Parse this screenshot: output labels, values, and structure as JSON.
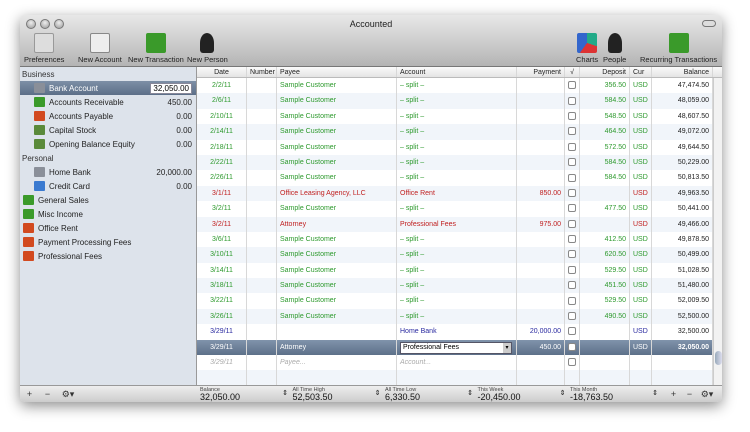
{
  "window": {
    "title": "Accounted"
  },
  "toolbar": {
    "preferences": "Preferences",
    "new_account": "New Account",
    "new_transaction": "New Transaction",
    "new_person": "New Person",
    "charts": "Charts",
    "people": "People",
    "recurring": "Recurring Transactions"
  },
  "sidebar": {
    "groups": [
      {
        "label": "Business",
        "items": [
          {
            "label": "Bank Account",
            "value": "32,050.00",
            "icon": "bank-icon",
            "selected": true
          },
          {
            "label": "Accounts Receivable",
            "value": "450.00",
            "icon": "income-icon"
          },
          {
            "label": "Accounts Payable",
            "value": "0.00",
            "icon": "expense-icon"
          },
          {
            "label": "Capital Stock",
            "value": "0.00",
            "icon": "equity-icon"
          },
          {
            "label": "Opening Balance Equity",
            "value": "0.00",
            "icon": "equity-icon"
          }
        ]
      },
      {
        "label": "Personal",
        "items": [
          {
            "label": "Home Bank",
            "value": "20,000.00",
            "icon": "bank-icon"
          },
          {
            "label": "Credit Card",
            "value": "0.00",
            "icon": "credit-card-icon"
          }
        ]
      }
    ],
    "categories": [
      {
        "label": "General Sales",
        "icon": "income-icon"
      },
      {
        "label": "Misc Income",
        "icon": "income-icon"
      },
      {
        "label": "Office Rent",
        "icon": "expense-icon"
      },
      {
        "label": "Payment Processing Fees",
        "icon": "expense-icon"
      },
      {
        "label": "Professional Fees",
        "icon": "expense-icon"
      }
    ]
  },
  "table": {
    "columns": [
      "Date",
      "Number",
      "Payee",
      "Account",
      "Payment",
      "√",
      "Deposit",
      "Cur",
      "Balance"
    ],
    "rows": [
      {
        "date": "2/2/11",
        "payee": "Sample Customer",
        "account": "– split –",
        "payment": "",
        "deposit": "356.50",
        "cur": "USD",
        "balance": "47,474.50",
        "color": "g"
      },
      {
        "date": "2/6/11",
        "payee": "Sample Customer",
        "account": "– split –",
        "payment": "",
        "deposit": "584.50",
        "cur": "USD",
        "balance": "48,059.00",
        "color": "g"
      },
      {
        "date": "2/10/11",
        "payee": "Sample Customer",
        "account": "– split –",
        "payment": "",
        "deposit": "548.50",
        "cur": "USD",
        "balance": "48,607.50",
        "color": "g"
      },
      {
        "date": "2/14/11",
        "payee": "Sample Customer",
        "account": "– split –",
        "payment": "",
        "deposit": "464.50",
        "cur": "USD",
        "balance": "49,072.00",
        "color": "g"
      },
      {
        "date": "2/18/11",
        "payee": "Sample Customer",
        "account": "– split –",
        "payment": "",
        "deposit": "572.50",
        "cur": "USD",
        "balance": "49,644.50",
        "color": "g"
      },
      {
        "date": "2/22/11",
        "payee": "Sample Customer",
        "account": "– split –",
        "payment": "",
        "deposit": "584.50",
        "cur": "USD",
        "balance": "50,229.00",
        "color": "g"
      },
      {
        "date": "2/26/11",
        "payee": "Sample Customer",
        "account": "– split –",
        "payment": "",
        "deposit": "584.50",
        "cur": "USD",
        "balance": "50,813.50",
        "color": "g"
      },
      {
        "date": "3/1/11",
        "payee": "Office Leasing Agency, LLC",
        "account": "Office Rent",
        "payment": "850.00",
        "deposit": "",
        "cur": "USD",
        "balance": "49,963.50",
        "color": "r"
      },
      {
        "date": "3/2/11",
        "payee": "Sample Customer",
        "account": "– split –",
        "payment": "",
        "deposit": "477.50",
        "cur": "USD",
        "balance": "50,441.00",
        "color": "g"
      },
      {
        "date": "3/2/11",
        "payee": "Attorney",
        "account": "Professional Fees",
        "payment": "975.00",
        "deposit": "",
        "cur": "USD",
        "balance": "49,466.00",
        "color": "r"
      },
      {
        "date": "3/6/11",
        "payee": "Sample Customer",
        "account": "– split –",
        "payment": "",
        "deposit": "412.50",
        "cur": "USD",
        "balance": "49,878.50",
        "color": "g"
      },
      {
        "date": "3/10/11",
        "payee": "Sample Customer",
        "account": "– split –",
        "payment": "",
        "deposit": "620.50",
        "cur": "USD",
        "balance": "50,499.00",
        "color": "g"
      },
      {
        "date": "3/14/11",
        "payee": "Sample Customer",
        "account": "– split –",
        "payment": "",
        "deposit": "529.50",
        "cur": "USD",
        "balance": "51,028.50",
        "color": "g"
      },
      {
        "date": "3/18/11",
        "payee": "Sample Customer",
        "account": "– split –",
        "payment": "",
        "deposit": "451.50",
        "cur": "USD",
        "balance": "51,480.00",
        "color": "g"
      },
      {
        "date": "3/22/11",
        "payee": "Sample Customer",
        "account": "– split –",
        "payment": "",
        "deposit": "529.50",
        "cur": "USD",
        "balance": "52,009.50",
        "color": "g"
      },
      {
        "date": "3/26/11",
        "payee": "Sample Customer",
        "account": "– split –",
        "payment": "",
        "deposit": "490.50",
        "cur": "USD",
        "balance": "52,500.00",
        "color": "g"
      },
      {
        "date": "3/29/11",
        "payee": "",
        "account": "Home Bank",
        "payment": "20,000.00",
        "deposit": "",
        "cur": "USD",
        "balance": "32,500.00",
        "color": "b"
      },
      {
        "date": "3/29/11",
        "payee": "Attorney",
        "account": "Professional Fees",
        "payment": "450.00",
        "deposit": "",
        "cur": "USD",
        "balance": "32,050.00",
        "color": "sel"
      }
    ],
    "new_row": {
      "date": "3/29/11",
      "payee_placeholder": "Payee...",
      "account_placeholder": "Account..."
    }
  },
  "stats": [
    {
      "label": "Balance",
      "value": "32,050.00"
    },
    {
      "label": "All Time High",
      "value": "52,503.50"
    },
    {
      "label": "All Time Low",
      "value": "6,330.50"
    },
    {
      "label": "This Week",
      "value": "-20,450.00"
    },
    {
      "label": "This Month",
      "value": "-18,763.50"
    }
  ]
}
